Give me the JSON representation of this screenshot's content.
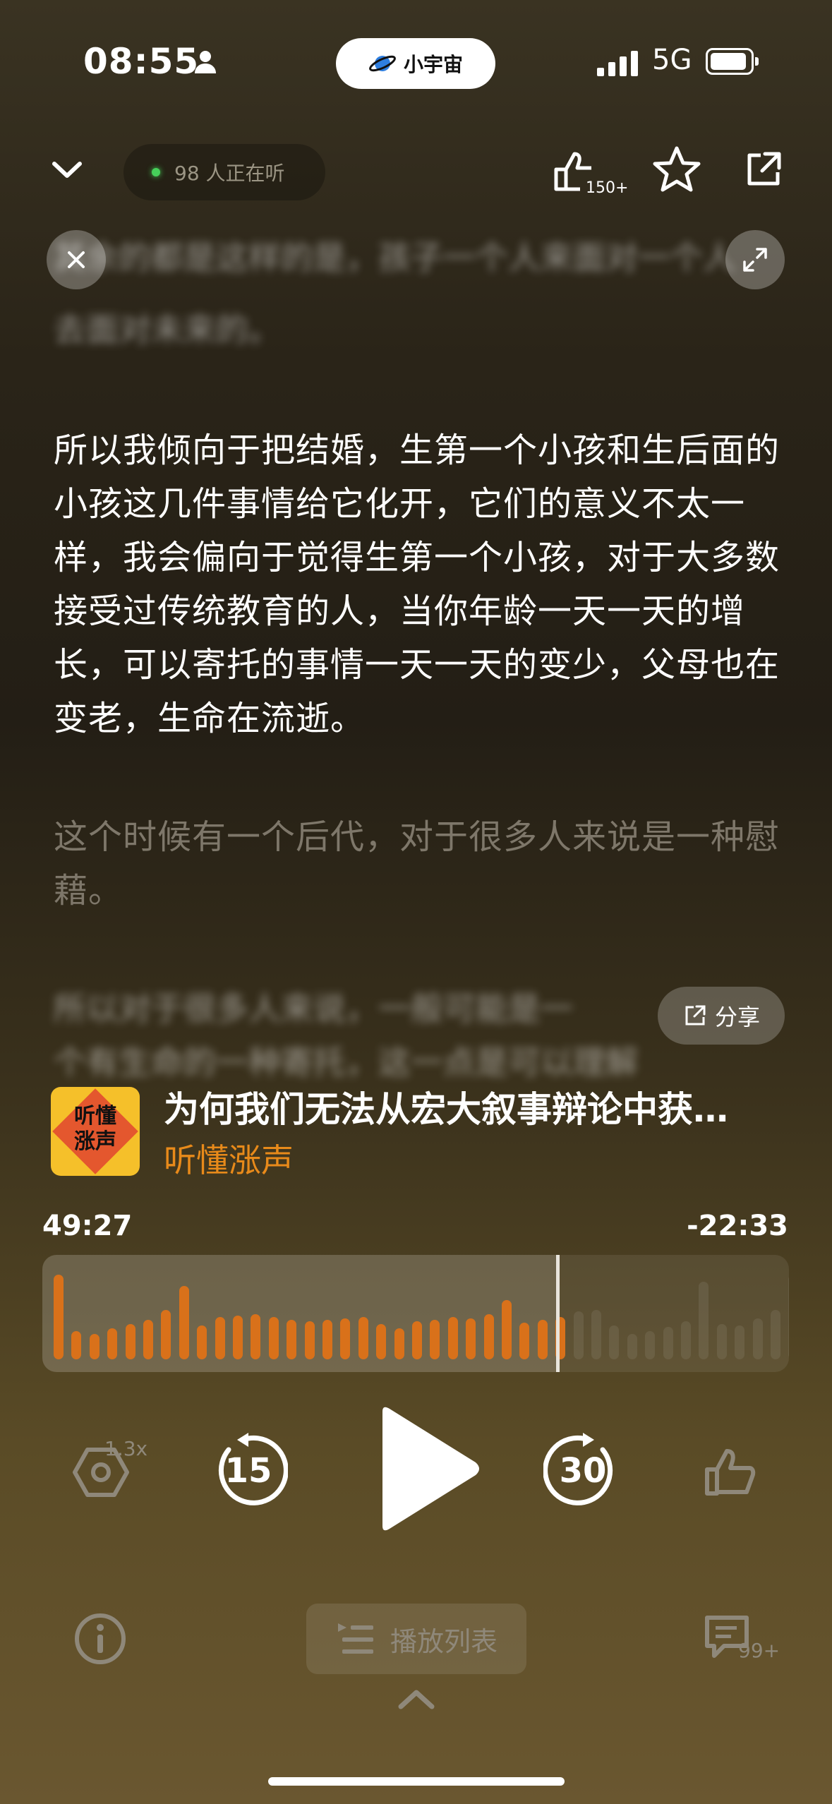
{
  "status_bar": {
    "time": "08:55",
    "app_pill": "小宇宙",
    "network": "5G"
  },
  "top_bar": {
    "listeners": "98 人正在听",
    "like_count": "150+"
  },
  "transcript": {
    "blurred_before_1": "其余的都是这样的是，孩子一个人来面对一个人",
    "blurred_before_2": "去面对未来的。",
    "current": "所以我倾向于把结婚，生第一个小孩和生后面的小孩这几件事情给它化开，它们的意义不太一样，我会偏向于觉得生第一个小孩，对于大多数接受过传统教育的人，当你年龄一天一天的增长，可以寄托的事情一天一天的变少，父母也在变老，生命在流逝。",
    "next": "这个时候有一个后代，对于很多人来说是一种慰藉。",
    "blurred_after_1": "所以对于很多人来说，一般可能是一",
    "blurred_after_2": "个有生命的一种寄托，这一点是可以理解"
  },
  "share_label": "分享",
  "episode": {
    "cover_text": "听懂\n涨声",
    "title": "为何我们无法从宏大叙事辩论中获…",
    "podcast": "听懂涨声"
  },
  "progress": {
    "elapsed": "49:27",
    "remaining": "-22:33",
    "played_fraction": 0.69
  },
  "controls": {
    "rate": "1.3x",
    "rewind": "15",
    "forward": "30"
  },
  "bottom": {
    "playlist": "播放列表",
    "comments": "99+"
  },
  "colors": {
    "accent": "#e88a1a",
    "wave_played": "#d9711a"
  }
}
